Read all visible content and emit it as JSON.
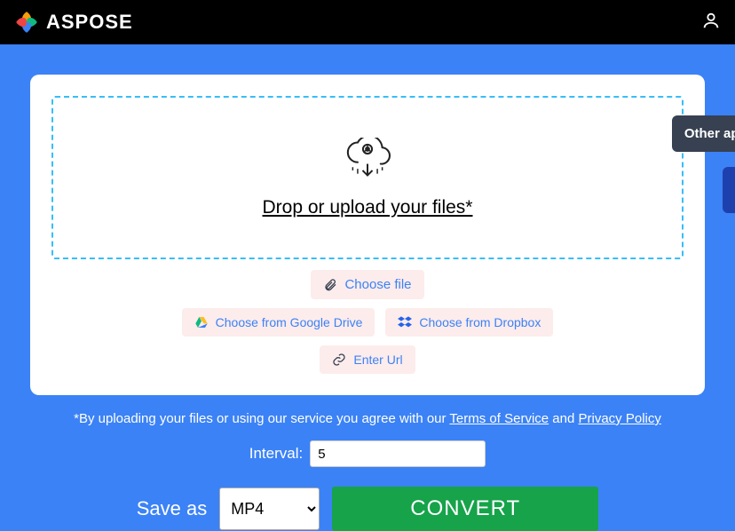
{
  "header": {
    "brand": "ASPOSE"
  },
  "sideTab": {
    "label": "Other apps"
  },
  "dropzone": {
    "heading": "Drop or upload your files*"
  },
  "sources": {
    "chooseFile": "Choose file",
    "googleDrive": "Choose from Google Drive",
    "dropbox": "Choose from Dropbox",
    "enterUrl": "Enter Url"
  },
  "disclaimer": {
    "prefix": "*By uploading your files or using our service you agree with our ",
    "tos": "Terms of Service",
    "and": " and ",
    "privacy": "Privacy Policy"
  },
  "interval": {
    "label": "Interval:",
    "value": "5"
  },
  "convert": {
    "saveAs": "Save as",
    "selected": "MP4",
    "button": "CONVERT"
  }
}
